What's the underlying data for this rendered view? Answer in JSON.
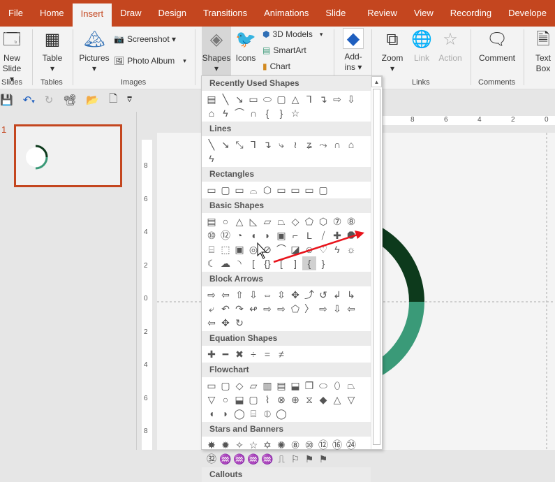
{
  "tabs": [
    "File",
    "Home",
    "Insert",
    "Draw",
    "Design",
    "Transitions",
    "Animations",
    "Slide Show",
    "Review",
    "View",
    "Recording",
    "Develope"
  ],
  "active_tab": "Insert",
  "ribbon": {
    "new_slide": "New",
    "new_slide2": "Slide ▾",
    "table": "Table",
    "table_arrow": "▾",
    "pictures": "Pictures",
    "pictures_arrow": "▾",
    "screenshot": "Screenshot ▾",
    "photo_album": "Photo Album",
    "photo_album_arrow": "▾",
    "shapes": "Shapes",
    "shapes_arrow": "▾",
    "icons": "Icons",
    "models": "3D Models",
    "models_arrow": "▾",
    "smartart": "SmartArt",
    "chart": "Chart",
    "addins": "Add-",
    "addins2": "ins ▾",
    "zoom": "Zoom",
    "zoom_arrow": "▾",
    "link": "Link",
    "action": "Action",
    "comment": "Comment",
    "textbox": "Text",
    "textbox2": "Box",
    "groups": {
      "slides": "Slides",
      "tables": "Tables",
      "images": "Images",
      "links": "Links",
      "comments": "Comments"
    }
  },
  "qat": {
    "save": "💾",
    "undo": "↶",
    "undo_arrow": "▾",
    "redo": "↻",
    "present": "📽",
    "open": "📂",
    "new": "🗋",
    "customize": "⩢"
  },
  "slides": {
    "number": "1"
  },
  "rulers": {
    "vertical": [
      "8",
      "6",
      "4",
      "2",
      "0",
      "2",
      "4",
      "6",
      "8"
    ],
    "horizontal": [
      "8",
      "6",
      "4",
      "2",
      "0"
    ]
  },
  "ring_colors": {
    "top": "#0d3a1c",
    "bottom": "#3a9a78"
  },
  "gallery": [
    {
      "title": "Recently Used Shapes",
      "shapes": [
        "▤",
        "╲",
        "↘",
        "▭",
        "⬭",
        "▢",
        "△",
        "⅂",
        "↴",
        "⇨",
        "⇩",
        "⌂",
        "ϟ",
        "⌒",
        "∩",
        "{",
        "}",
        "☆"
      ]
    },
    {
      "title": "Lines",
      "shapes": [
        "╲",
        "↘",
        "⤡",
        "⅂",
        "↴",
        "⤷",
        "≀",
        "ʑ",
        "⤳",
        "∩",
        "⌂",
        "ϟ"
      ]
    },
    {
      "title": "Rectangles",
      "shapes": [
        "▭",
        "▢",
        "▭",
        "⌓",
        "⬡",
        "▭",
        "▭",
        "▭",
        "▢"
      ]
    },
    {
      "title": "Basic Shapes",
      "shapes": [
        "▤",
        "○",
        "△",
        "◺",
        "▱",
        "⏢",
        "◇",
        "⬠",
        "⬡",
        "⑦",
        "⑧",
        "⑩",
        "⑫",
        "◔",
        "◖",
        "◗",
        "▣",
        "⌐",
        "L",
        "⧸",
        "✚",
        "⯃",
        "⌸",
        "⬚",
        "▣",
        "◎",
        "⊘",
        "⌒",
        "◪",
        "☺",
        "♡",
        "ϟ",
        "☼",
        "☾",
        "☁",
        "◝",
        "[",
        "{}",
        "[",
        "]",
        "{",
        "}"
      ],
      "selected_index": 40
    },
    {
      "title": "Block Arrows",
      "shapes": [
        "⇨",
        "⇦",
        "⇧",
        "⇩",
        "⇔",
        "⇳",
        "✥",
        "⤴",
        "↺",
        "↲",
        "↳",
        "⤶",
        "↶",
        "↷",
        "↫",
        "⇨",
        "⇨",
        "⬠",
        "〉",
        "⇨",
        "⇩",
        "⇦",
        "⇦",
        "✥",
        "↻"
      ]
    },
    {
      "title": "Equation Shapes",
      "shapes": [
        "✚",
        "━",
        "✖",
        "÷",
        "=",
        "≠"
      ]
    },
    {
      "title": "Flowchart",
      "shapes": [
        "▭",
        "▢",
        "◇",
        "▱",
        "▥",
        "▤",
        "⬓",
        "❐",
        "⬭",
        "⬯",
        "⏢",
        "▽",
        "○",
        "⬓",
        "▢",
        "⌇",
        "⊗",
        "⊕",
        "⧖",
        "◆",
        "△",
        "▽",
        "◖",
        "◗",
        "◯",
        "⌸",
        "⦶",
        "◯"
      ]
    },
    {
      "title": "Stars and Banners",
      "shapes": [
        "✸",
        "✹",
        "✧",
        "☆",
        "✡",
        "✺",
        "⑧",
        "⑩",
        "⑫",
        "⑯",
        "㉔",
        "㉜",
        "♒",
        "♒",
        "♒",
        "♒",
        "⎍",
        "⚐",
        "⚑",
        "⚑"
      ]
    },
    {
      "title": "Callouts",
      "shapes": []
    }
  ],
  "annotation_color": "#e8141c"
}
